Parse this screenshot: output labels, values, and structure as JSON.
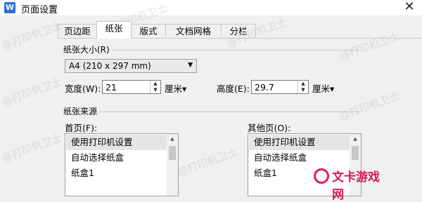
{
  "window": {
    "app_icon": "W",
    "title": "页面设置",
    "close_glyph": "✕"
  },
  "tabs": [
    {
      "label": "页边距"
    },
    {
      "label": "纸张"
    },
    {
      "label": "版式"
    },
    {
      "label": "文档网格"
    },
    {
      "label": "分栏"
    }
  ],
  "active_tab": "纸张",
  "paper_size": {
    "section_title": "纸张大小(R)",
    "selected": "A4 (210 x 297 mm)",
    "width_label": "宽度(W):",
    "width_value": "21",
    "width_unit": "厘米▾",
    "height_label": "高度(E):",
    "height_value": "29.7",
    "height_unit": "厘米▾"
  },
  "paper_source": {
    "section_title": "纸张来源",
    "first_page_label": "首页(F):",
    "first_page_items": [
      "使用打印机设置",
      "自动选择纸盒",
      "纸盒1"
    ],
    "other_pages_label": "其他页(O):",
    "other_pages_items": [
      "使用打印机设置",
      "自动选择纸盒",
      "纸盒1"
    ]
  },
  "watermark": {
    "text": "@打印机卫士"
  },
  "brand": {
    "name": "文卡游戏网"
  }
}
